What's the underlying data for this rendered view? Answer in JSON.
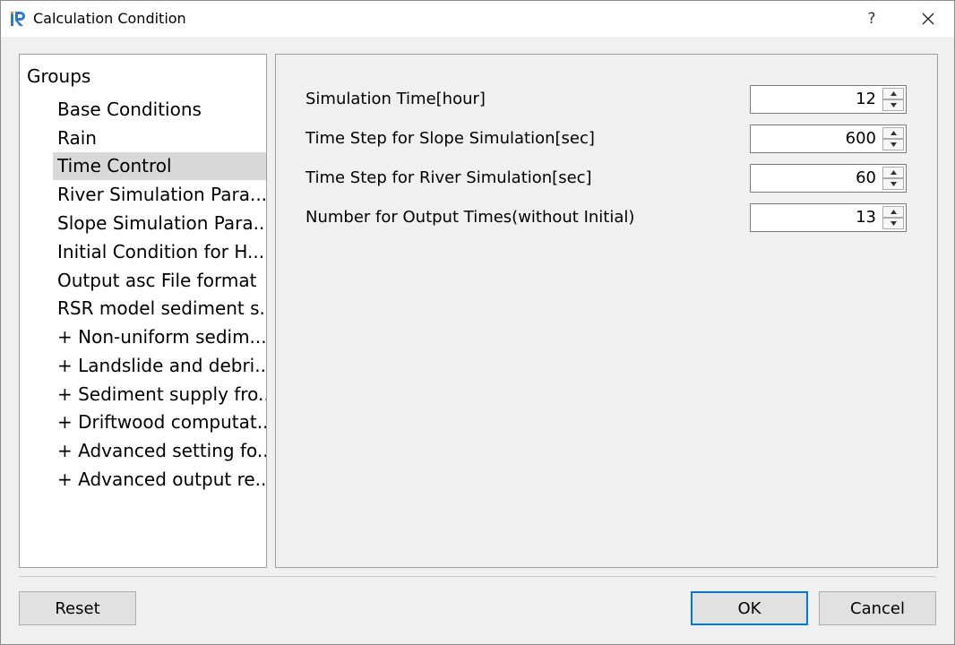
{
  "window": {
    "title": "Calculation Condition",
    "help_label": "?"
  },
  "groups": {
    "header": "Groups",
    "items": [
      {
        "label": "Base Conditions",
        "selected": false
      },
      {
        "label": "Rain",
        "selected": false
      },
      {
        "label": "Time Control",
        "selected": true
      },
      {
        "label": "River Simulation Para...",
        "selected": false
      },
      {
        "label": "Slope Simulation Para...",
        "selected": false
      },
      {
        "label": "Initial Condition for H...",
        "selected": false
      },
      {
        "label": "Output asc File format",
        "selected": false
      },
      {
        "label": "RSR model sediment s...",
        "selected": false
      },
      {
        "label": "+ Non-uniform sedim...",
        "selected": false
      },
      {
        "label": "+ Landslide and debri...",
        "selected": false
      },
      {
        "label": "+ Sediment supply fro...",
        "selected": false
      },
      {
        "label": "+ Driftwood computat...",
        "selected": false
      },
      {
        "label": "+ Advanced setting fo...",
        "selected": false
      },
      {
        "label": "+ Advanced output re...",
        "selected": false
      }
    ]
  },
  "fields": [
    {
      "label": "Simulation Time[hour]",
      "value": "12"
    },
    {
      "label": "Time Step for Slope Simulation[sec]",
      "value": "600"
    },
    {
      "label": "Time Step for River Simulation[sec]",
      "value": "60"
    },
    {
      "label": "Number for Output Times(without Initial)",
      "value": "13"
    }
  ],
  "buttons": {
    "reset": "Reset",
    "ok": "OK",
    "cancel": "Cancel"
  },
  "colors": {
    "accent": "#0078d7",
    "selection": "#d9d9d9",
    "icon_blue": "#2b7bd4"
  },
  "icons": {
    "app": "irc-logo-icon",
    "close": "close-icon",
    "spin_up": "chevron-up-icon",
    "spin_down": "chevron-down-icon"
  }
}
